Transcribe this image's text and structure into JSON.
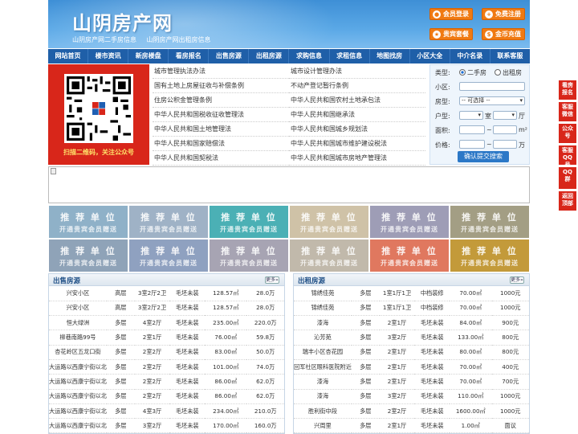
{
  "header": {
    "logo": "山阴房产网",
    "sub": [
      "山阴房产网二手房信息",
      "山阴房产网出租房信息"
    ],
    "buttons": [
      {
        "label": "会员登录",
        "icon": "user-icon"
      },
      {
        "label": "免费注册",
        "icon": "register-icon"
      },
      {
        "label": "贵宾套餐",
        "icon": "vip-icon"
      },
      {
        "label": "金币充值",
        "icon": "coin-icon"
      }
    ]
  },
  "nav": [
    "网站首页",
    "楼市资讯",
    "新房楼盘",
    "看房报名",
    "出售房源",
    "出租房源",
    "求购信息",
    "求租信息",
    "地图找房",
    "小区大全",
    "中介名录",
    "联系客服"
  ],
  "qr": {
    "caption": "扫描二维码，关注公众号"
  },
  "laws": {
    "left": [
      "城市管理执法办法",
      "国有土地上房屋征收与补偿条例",
      "住房公积金管理条例",
      "中华人民共和国税收征收管理法",
      "中华人民共和国土地管理法",
      "中华人民共和国家赔偿法",
      "中华人民共和国契税法"
    ],
    "right": [
      "城市设计管理办法",
      "不动产登记暂行条例",
      "中华人民共和国农村土地承包法",
      "中华人民共和国继承法",
      "中华人民共和国城乡规划法",
      "中华人民共和国城市维护建设税法",
      "中华人民共和国城市房地产管理法"
    ]
  },
  "search": {
    "type_label": "类型:",
    "opt1": "二手房",
    "opt2": "出租房",
    "community_label": "小区:",
    "house_label": "房型:",
    "house_select": "-- 可选择 --",
    "layout_label": "户型:",
    "room": "室",
    "hall": "厅",
    "area_label": "面积:",
    "area_unit": "m²",
    "price_label": "价格:",
    "price_unit": "万",
    "sep": "~",
    "button": "确认提交搜索"
  },
  "tile": {
    "title": "推 荐 单 位",
    "sub": "开通贵宾会员赠送",
    "colors": [
      "#8fb1c8",
      "#9fb2c6",
      "#4bb0b5",
      "#cfc2a7",
      "#9e9db6",
      "#a39e84",
      "#8fa3b8",
      "#8fa1c0",
      "#a7a4b3",
      "#c1b9ab",
      "#e0785f",
      "#c39a3a"
    ]
  },
  "sale": {
    "title": "出售房源",
    "more": "更多»",
    "rows": [
      [
        "兴安小区",
        "高层",
        "3室2厅2卫",
        "毛坯未装",
        "128.57㎡",
        "28.0万"
      ],
      [
        "兴安小区",
        "高层",
        "3室2厅2卫",
        "毛坯未装",
        "128.57㎡",
        "28.0万"
      ],
      [
        "恒大绿洲",
        "多层",
        "4室2厅",
        "毛坯未装",
        "235.00㎡",
        "220.0万"
      ],
      [
        "柳巷南路99号",
        "多层",
        "2室1厅",
        "毛坯未装",
        "76.00㎡",
        "59.8万"
      ],
      [
        "杏花岭区五龙口街",
        "多层",
        "2室2厅",
        "毛坯未装",
        "83.00㎡",
        "50.0万"
      ],
      [
        "大运路以西康宁街以北",
        "多层",
        "2室2厅",
        "毛坯未装",
        "101.00㎡",
        "74.0万"
      ],
      [
        "大运路以西康宁街以北",
        "多层",
        "2室2厅",
        "毛坯未装",
        "86.00㎡",
        "62.0万"
      ],
      [
        "大运路以西康宁街以北",
        "多层",
        "2室2厅",
        "毛坯未装",
        "86.00㎡",
        "62.0万"
      ],
      [
        "大运路以西康宁街以北",
        "多层",
        "4室3厅",
        "毛坯未装",
        "234.00㎡",
        "210.0万"
      ],
      [
        "大运路以西康宁街以北",
        "多层",
        "3室2厅",
        "毛坯未装",
        "170.00㎡",
        "160.0万"
      ]
    ]
  },
  "rent": {
    "title": "出租房源",
    "more": "更多»",
    "rows": [
      [
        "锦绣佳苑",
        "多层",
        "1室1厅1卫",
        "中档装修",
        "70.00㎡",
        "1000元"
      ],
      [
        "锦绣佳苑",
        "多层",
        "1室1厅1卫",
        "中档装修",
        "70.00㎡",
        "1000元"
      ],
      [
        "漆海",
        "多层",
        "2室1厅",
        "毛坯未装",
        "84.00㎡",
        "900元"
      ],
      [
        "沁芳苑",
        "多层",
        "3室2厅",
        "毛坯未装",
        "133.00㎡",
        "800元"
      ],
      [
        "瑞丰小区杏花园",
        "多层",
        "2室1厅",
        "毛坯未装",
        "80.00㎡",
        "800元"
      ],
      [
        "回军社区眼科医院附近",
        "多层",
        "2室1厅",
        "毛坯未装",
        "70.00㎡",
        "400元"
      ],
      [
        "漆海",
        "多层",
        "2室1厅",
        "毛坯未装",
        "70.00㎡",
        "700元"
      ],
      [
        "漆海",
        "多层",
        "3室2厅",
        "毛坯未装",
        "110.00㎡",
        "1000元"
      ],
      [
        "胜利街中段",
        "多层",
        "2室2厅",
        "毛坯未装",
        "1600.00㎡",
        "1000元"
      ],
      [
        "兴周里",
        "多层",
        "2室1厅",
        "毛坯未装",
        "1.00㎡",
        "面议"
      ]
    ]
  },
  "side": [
    "看房报名",
    "客服微信",
    "公众号",
    "客服QQ号",
    "QQ群",
    "返回顶部"
  ]
}
